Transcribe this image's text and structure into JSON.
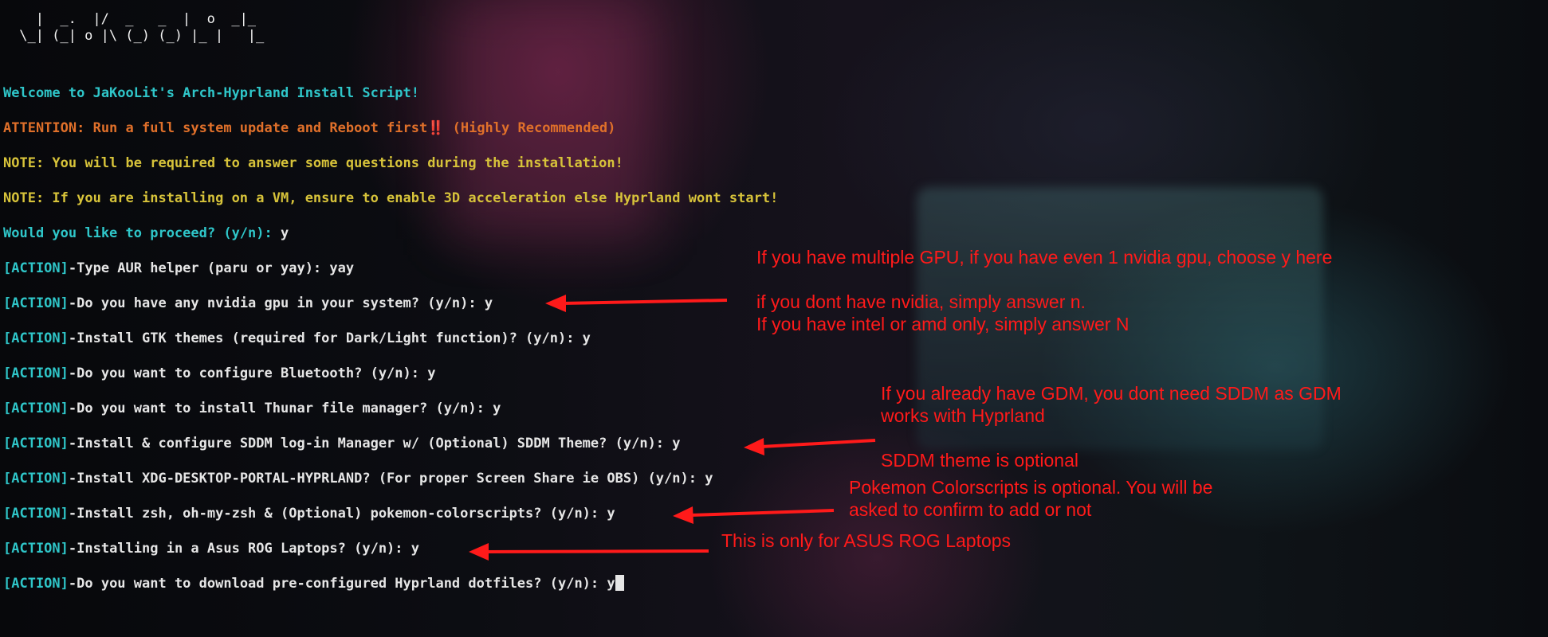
{
  "ascii_logo": "   |  _.  |/  _   _  |  o  _|_\n \\_| (_| o |\\ (_) (_) |_ |   |_",
  "lines": {
    "welcome": "Welcome to JaKooLit's Arch-Hyprland Install Script!",
    "attention": "ATTENTION: Run a full system update and Reboot first‼️ (Highly Recommended)",
    "note1": "NOTE: You will be required to answer some questions during the installation!",
    "note2": "NOTE: If you are installing on a VM, ensure to enable 3D acceleration else Hyprland wont start!",
    "proceed_prompt": "Would you like to proceed? (y/n):",
    "proceed_answer": " y"
  },
  "action_tag": "[ACTION]",
  "actions": [
    {
      "text": "-Type AUR helper (paru or yay): yay"
    },
    {
      "text": "-Do you have any nvidia gpu in your system? (y/n): y"
    },
    {
      "text": "-Install GTK themes (required for Dark/Light function)? (y/n): y"
    },
    {
      "text": "-Do you want to configure Bluetooth? (y/n): y"
    },
    {
      "text": "-Do you want to install Thunar file manager? (y/n): y"
    },
    {
      "text": "-Install & configure SDDM log-in Manager w/ (Optional) SDDM Theme? (y/n): y"
    },
    {
      "text": "-Install XDG-DESKTOP-PORTAL-HYPRLAND? (For proper Screen Share ie OBS) (y/n): y"
    },
    {
      "text": "-Install zsh, oh-my-zsh & (Optional) pokemon-colorscripts? (y/n): y"
    },
    {
      "text": "-Installing in a Asus ROG Laptops? (y/n): y"
    },
    {
      "text": "-Do you want to download pre-configured Hyprland dotfiles? (y/n): y"
    }
  ],
  "annotations": {
    "gpu_multi": "If you have multiple GPU, if you have even 1 nvidia gpu, choose y here",
    "gpu_none": "if you dont have nvidia, simply answer n.\nIf you have intel or amd only, simply answer N",
    "gdm": "If you already have GDM, you dont need SDDM as GDM\nworks with Hyprland",
    "sddm_theme": "SDDM theme is optional",
    "pokemon": "Pokemon Colorscripts is optional. You will be\nasked to confirm to add or not",
    "rog": "This is only for ASUS ROG Laptops"
  },
  "colors": {
    "cyan": "#2fc6c9",
    "orange": "#e0702a",
    "yellow": "#d7c33a",
    "annotation_red": "#ff1a1a"
  }
}
